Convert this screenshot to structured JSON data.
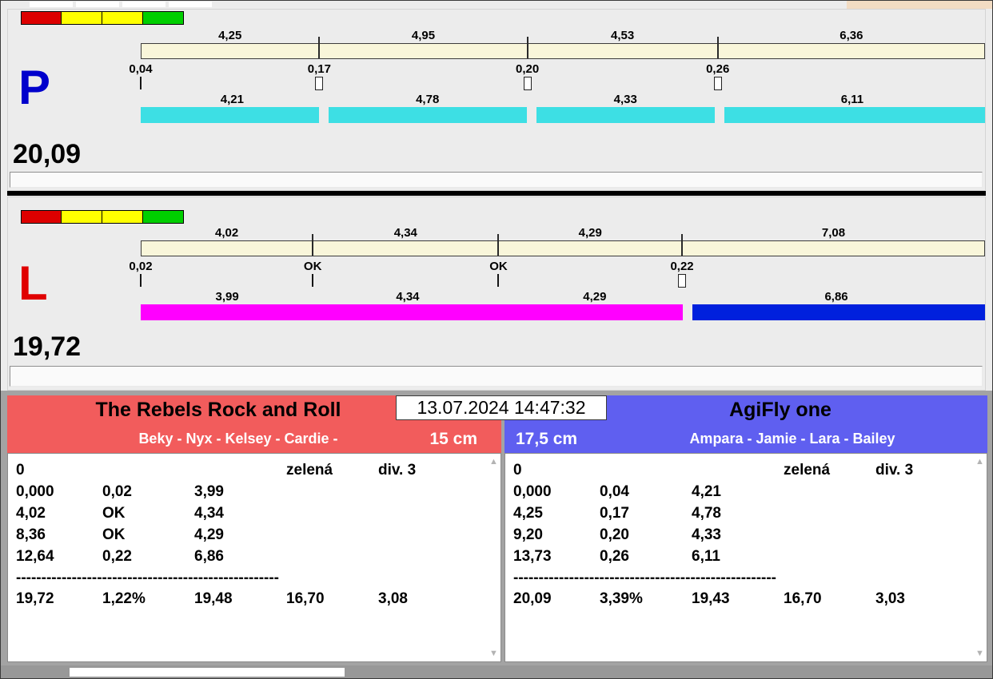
{
  "window": {
    "accent_cream": "#f9f6da",
    "corner_color": "#f2dcc3"
  },
  "panels": [
    {
      "letter": "P",
      "letter_color": "#0000cc",
      "total": "20,09",
      "indicator_colors": [
        "#dd0000",
        "#ffff00",
        "#ffff00",
        "#00cf00"
      ],
      "upper_segments": [
        {
          "label": "4,25",
          "value": 4.25
        },
        {
          "label": "4,95",
          "value": 4.95
        },
        {
          "label": "4,53",
          "value": 4.53
        },
        {
          "label": "6,36",
          "value": 6.36
        }
      ],
      "checkpoints": [
        {
          "label": "0,04",
          "marker": "line"
        },
        {
          "label": "0,17",
          "marker": "box"
        },
        {
          "label": "0,20",
          "marker": "box"
        },
        {
          "label": "0,26",
          "marker": "box"
        }
      ],
      "lower_segments": [
        {
          "label": "4,21",
          "value": 4.21,
          "color": "#3ddfe4",
          "gap_before": false
        },
        {
          "label": "4,78",
          "value": 4.78,
          "color": "#3ddfe4",
          "gap_before": true
        },
        {
          "label": "4,33",
          "value": 4.33,
          "color": "#3ddfe4",
          "gap_before": true
        },
        {
          "label": "6,11",
          "value": 6.11,
          "color": "#3ddfe4",
          "gap_before": true
        }
      ]
    },
    {
      "letter": "L",
      "letter_color": "#e00000",
      "total": "19,72",
      "indicator_colors": [
        "#dd0000",
        "#ffff00",
        "#ffff00",
        "#00cf00"
      ],
      "upper_segments": [
        {
          "label": "4,02",
          "value": 4.02
        },
        {
          "label": "4,34",
          "value": 4.34
        },
        {
          "label": "4,29",
          "value": 4.29
        },
        {
          "label": "7,08",
          "value": 7.08
        }
      ],
      "checkpoints": [
        {
          "label": "0,02",
          "marker": "line"
        },
        {
          "label": "OK",
          "marker": "line"
        },
        {
          "label": "OK",
          "marker": "line"
        },
        {
          "label": "0,22",
          "marker": "box"
        }
      ],
      "lower_segments": [
        {
          "label": "3,99",
          "value": 3.99,
          "color": "#ff00ff",
          "gap_before": false
        },
        {
          "label": "4,34",
          "value": 4.34,
          "color": "#ff00ff",
          "gap_before": false
        },
        {
          "label": "4,29",
          "value": 4.29,
          "color": "#ff00ff",
          "gap_before": false
        },
        {
          "label": "6,86",
          "value": 6.86,
          "color": "#0020dd",
          "gap_before": true
        }
      ]
    }
  ],
  "timestamp": "13.07.2024 14:47:32",
  "teams": [
    {
      "name": "The Rebels Rock and Roll",
      "members": "Beky - Nyx - Kelsey - Cardie -",
      "height": "15 cm",
      "header_color": "#f25c5c",
      "info_row": {
        "faults": "0",
        "status": "zelená",
        "division": "div. 3"
      },
      "splits": [
        [
          "0,000",
          "0,02",
          "3,99"
        ],
        [
          "4,02",
          "OK",
          "4,34"
        ],
        [
          "8,36",
          "OK",
          "4,29"
        ],
        [
          "12,64",
          "0,22",
          "6,86"
        ]
      ],
      "divider": "----------------------------------------------------",
      "summary": [
        "19,72",
        "1,22%",
        "19,48",
        "16,70",
        "3,08"
      ]
    },
    {
      "name": "AgiFly one",
      "members": "Ampara - Jamie - Lara - Bailey",
      "height": "17,5 cm",
      "header_color": "#5f5ff0",
      "info_row": {
        "faults": "0",
        "status": "zelená",
        "division": "div. 3"
      },
      "splits": [
        [
          "0,000",
          "0,04",
          "4,21"
        ],
        [
          "4,25",
          "0,17",
          "4,78"
        ],
        [
          "9,20",
          "0,20",
          "4,33"
        ],
        [
          "13,73",
          "0,26",
          "6,11"
        ]
      ],
      "divider": "----------------------------------------------------",
      "summary": [
        "20,09",
        "3,39%",
        "19,43",
        "16,70",
        "3,03"
      ]
    }
  ],
  "scrollbar": {
    "up": "▲",
    "down": "▼"
  }
}
